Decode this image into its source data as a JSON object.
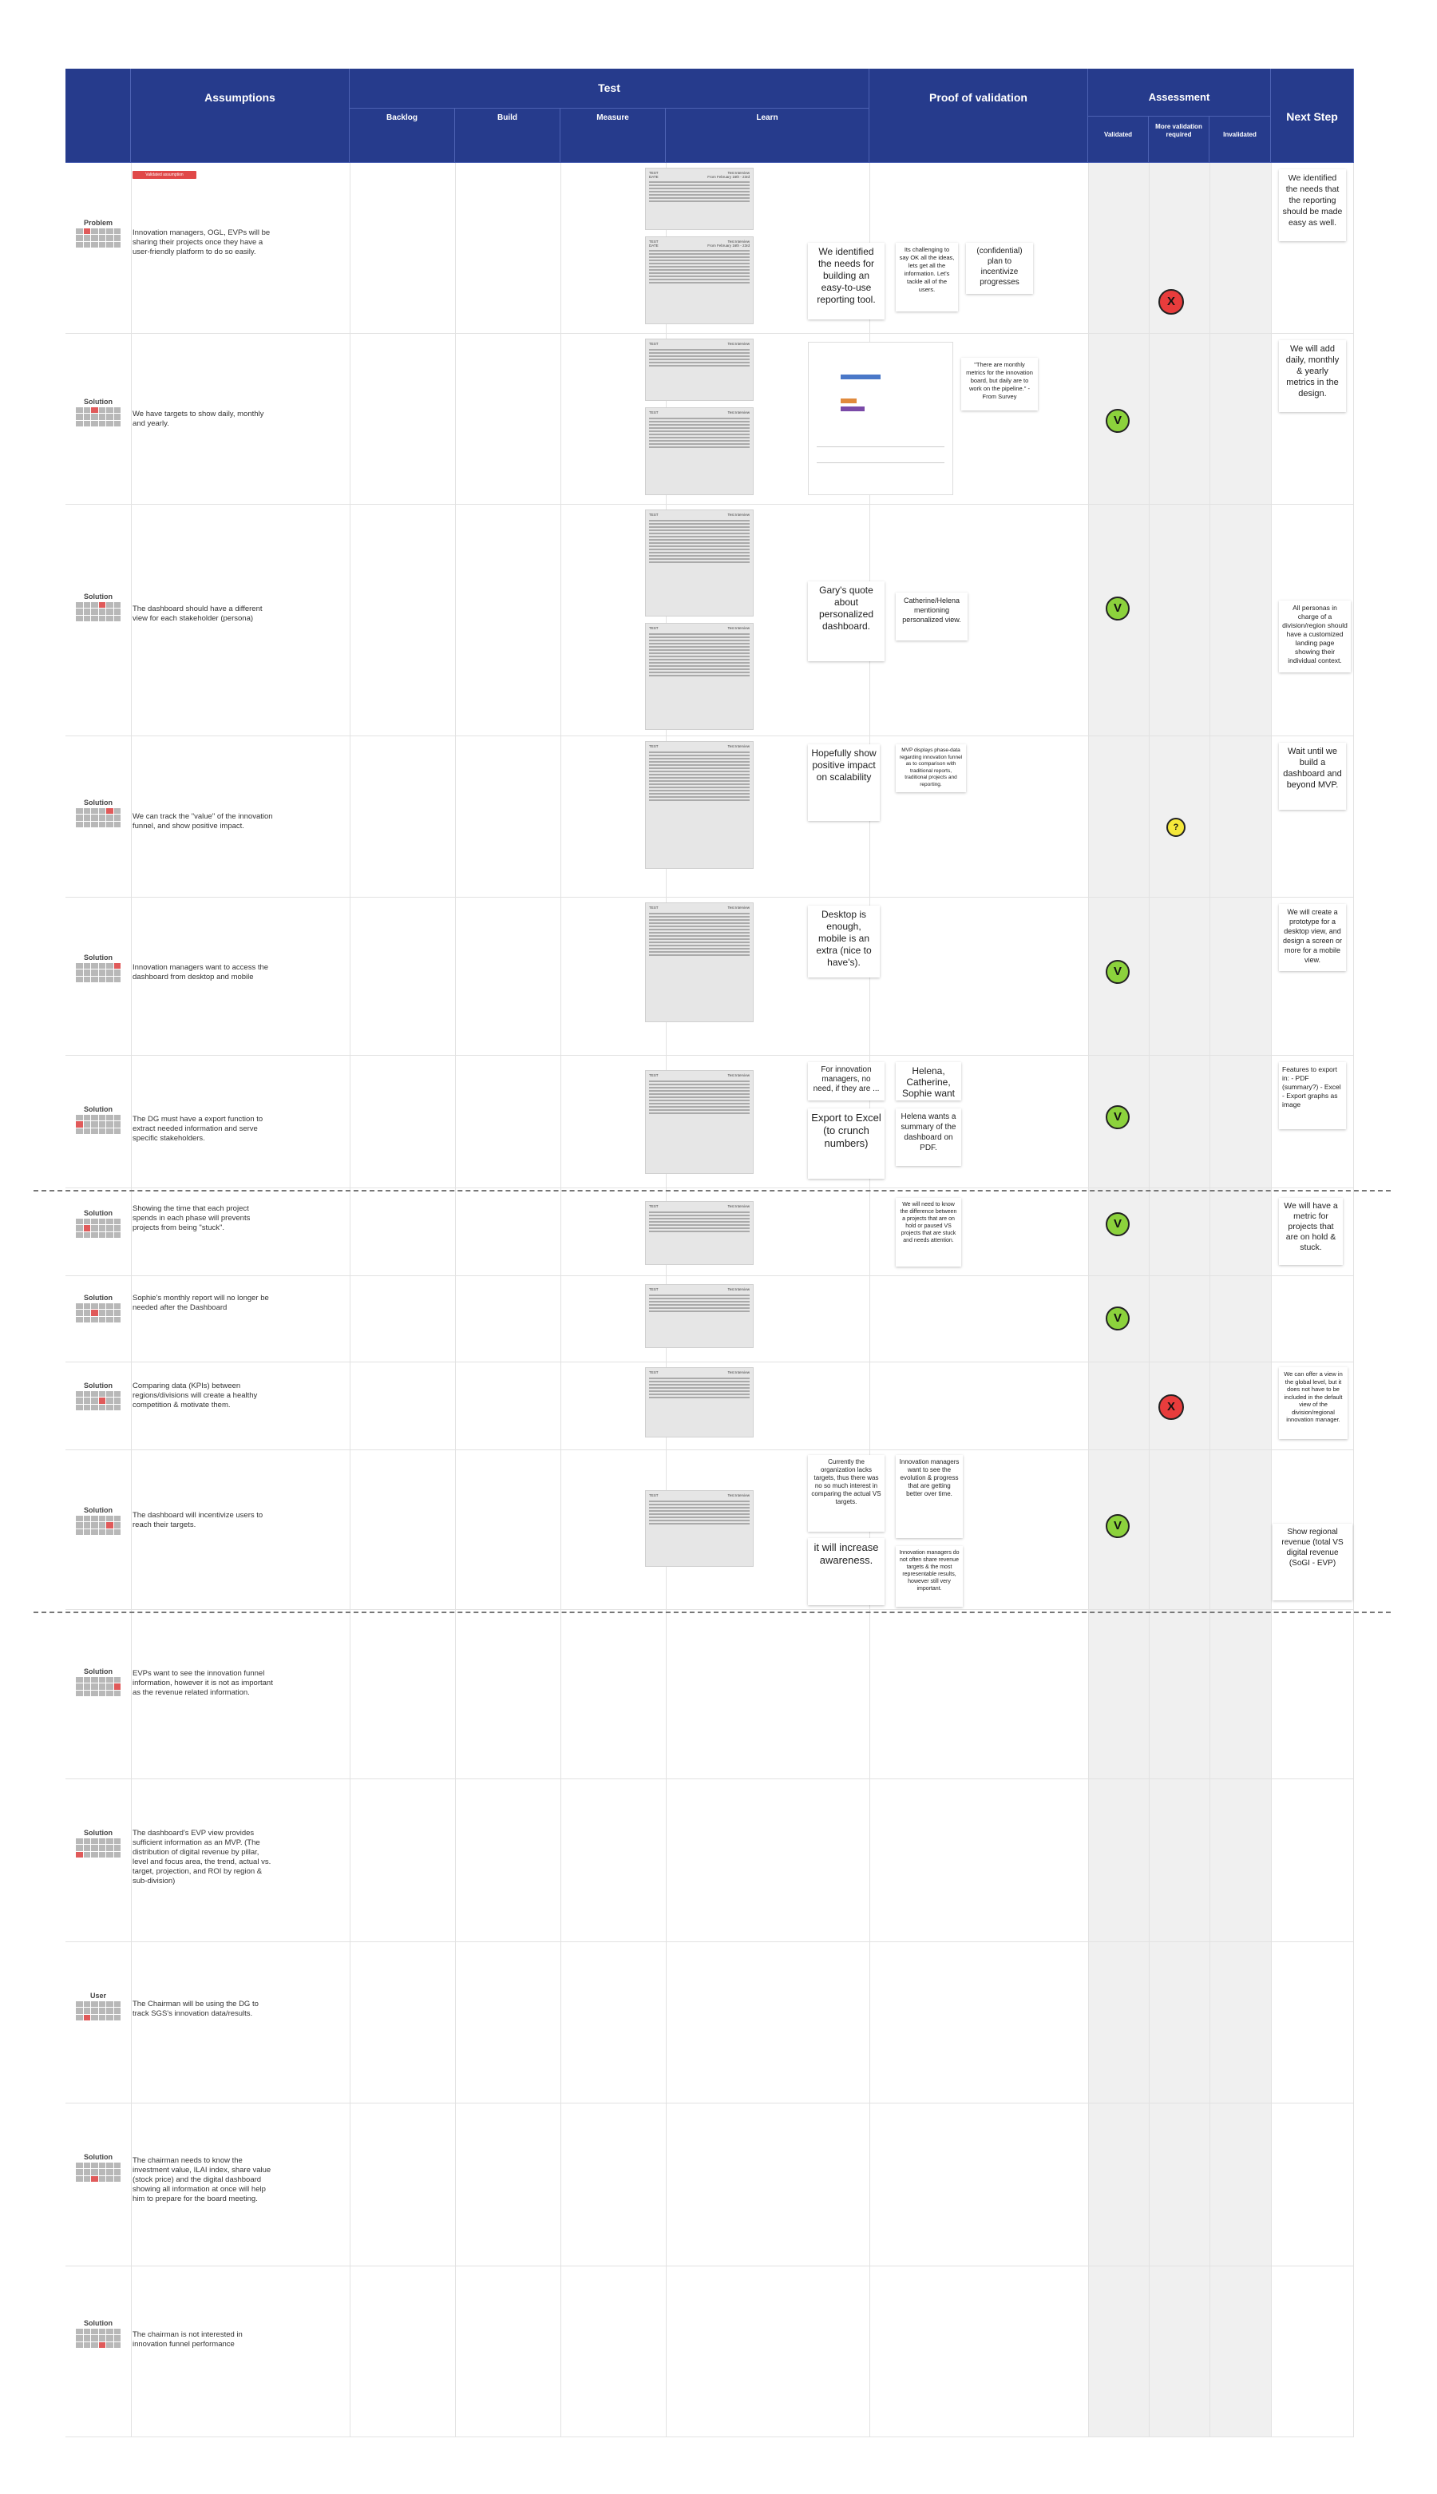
{
  "header": {
    "assumptions": "Assumptions",
    "test": "Test",
    "backlog": "Backlog",
    "build": "Build",
    "measure": "Measure",
    "learn": "Learn",
    "proof": "Proof of validation",
    "assessment": "Assessment",
    "validated": "Validated",
    "more_validation": "More validation required",
    "invalidated": "Invalidated",
    "next_step": "Next Step"
  },
  "rows": [
    {
      "type": "Problem",
      "badge": "Validated assumption",
      "text": "Innovation managers, OGL, EVPs will be sharing their projects once they have a user-friendly platform to do so easily.",
      "notes": [
        "We identified the needs for building an easy-to-use reporting tool.",
        "Its challenging to say OK all the ideas, lets get all the information. Let's tackle all of the users.",
        "(confidential) plan to incentivize progresses"
      ],
      "next": "We identified the needs that the reporting should be made easy as well."
    },
    {
      "type": "Solution",
      "text": "We have targets to show daily, monthly and yearly.",
      "notes": [
        "\"There are monthly metrics for the innovation board, but daily are to work on the pipeline.\" - From Survey"
      ],
      "next": "We will add daily, monthly & yearly metrics in the design."
    },
    {
      "type": "Solution",
      "text": "The dashboard should have a different view for each stakeholder (persona)",
      "notes": [
        "Gary's quote about personalized dashboard.",
        "Catherine/Helena mentioning personalized view."
      ],
      "next": "All personas in charge of a division/region should have a customized landing page showing their individual context."
    },
    {
      "type": "Solution",
      "text": "We can track the \"value\" of the innovation funnel, and show positive impact.",
      "notes": [
        "Hopefully show positive impact on scalability",
        "MVP displays phase-data regarding innovation funnel as to comparison with traditional reports, traditional projects and reporting."
      ],
      "next": "Wait until we build a dashboard and beyond MVP."
    },
    {
      "type": "Solution",
      "text": "Innovation managers want to access the dashboard from desktop and mobile",
      "notes": [
        "Desktop is enough, mobile is an extra (nice to have's)."
      ],
      "next": "We will create a prototype for a desktop view, and design a screen or more for a mobile view."
    },
    {
      "type": "Solution",
      "text": "The DG must have a export function to extract needed information and serve specific stakeholders.",
      "notes": [
        "For innovation managers, no need, if they are ...",
        "Helena, Catherine, Sophie want",
        "Export to Excel (to crunch numbers)",
        "Helena wants a summary of the dashboard on PDF."
      ],
      "next": "Features to export in: - PDF (summary?) - Excel - Export graphs as image"
    },
    {
      "type": "Solution",
      "text": "Showing the time that each project spends in each phase will prevents projects from being \"stuck\".",
      "notes": [
        "We will need to know the difference between a projects that are on hold or paused VS projects that are stuck and needs attention."
      ],
      "next": "We will have a metric for projects that are on hold & stuck."
    },
    {
      "type": "Solution",
      "text": "Sophie's monthly report will no longer be needed after the Dashboard",
      "notes": [],
      "next": ""
    },
    {
      "type": "Solution",
      "text": "Comparing data (KPIs) between regions/divisions will create a healthy competition & motivate them.",
      "notes": [],
      "next": "We can offer a view in the global level, but it does not have to be included in the default view of the division/regional innovation manager."
    },
    {
      "type": "Solution",
      "text": "The dashboard will incentivize users to reach their targets.",
      "notes": [
        "Currently the organization lacks targets, thus there was no so much interest in comparing the actual VS targets.",
        "Innovation managers want to see the evolution & progress that are getting better over time.",
        "it will increase awareness.",
        "Innovation managers do not often share revenue targets & the most representable results, however still very important."
      ],
      "next": "Show regional revenue (total VS digital revenue (SoGI - EVP)"
    },
    {
      "type": "Solution",
      "text": "EVPs want to see the innovation funnel information, however it is not as important as the revenue related information.",
      "notes": [],
      "next": ""
    },
    {
      "type": "Solution",
      "text": "The dashboard's EVP view provides sufficient information as an MVP. (The distribution of digital revenue by pillar, level and focus area, the trend, actual vs. target, projection, and ROI by region & sub-division)",
      "notes": [],
      "next": ""
    },
    {
      "type": "User",
      "text": "The Chairman will be using the DG to track SGS's innovation data/results.",
      "notes": [],
      "next": ""
    },
    {
      "type": "Solution",
      "text": "The chairman needs to know the investment value, ILAI index, share value (stock price) and the digital dashboard showing all information at once will help him to prepare for the board meeting.",
      "notes": [],
      "next": ""
    },
    {
      "type": "Solution",
      "text": "The chairman is not interested in innovation funnel performance",
      "notes": [],
      "next": ""
    }
  ],
  "card": {
    "left_label": "TEST",
    "right_label": "Test Interview",
    "left_label2": "DATE",
    "right_label2": "From February 16th - 23rd"
  },
  "assessment_marks": {
    "v": "V",
    "x": "X",
    "q": "?"
  }
}
